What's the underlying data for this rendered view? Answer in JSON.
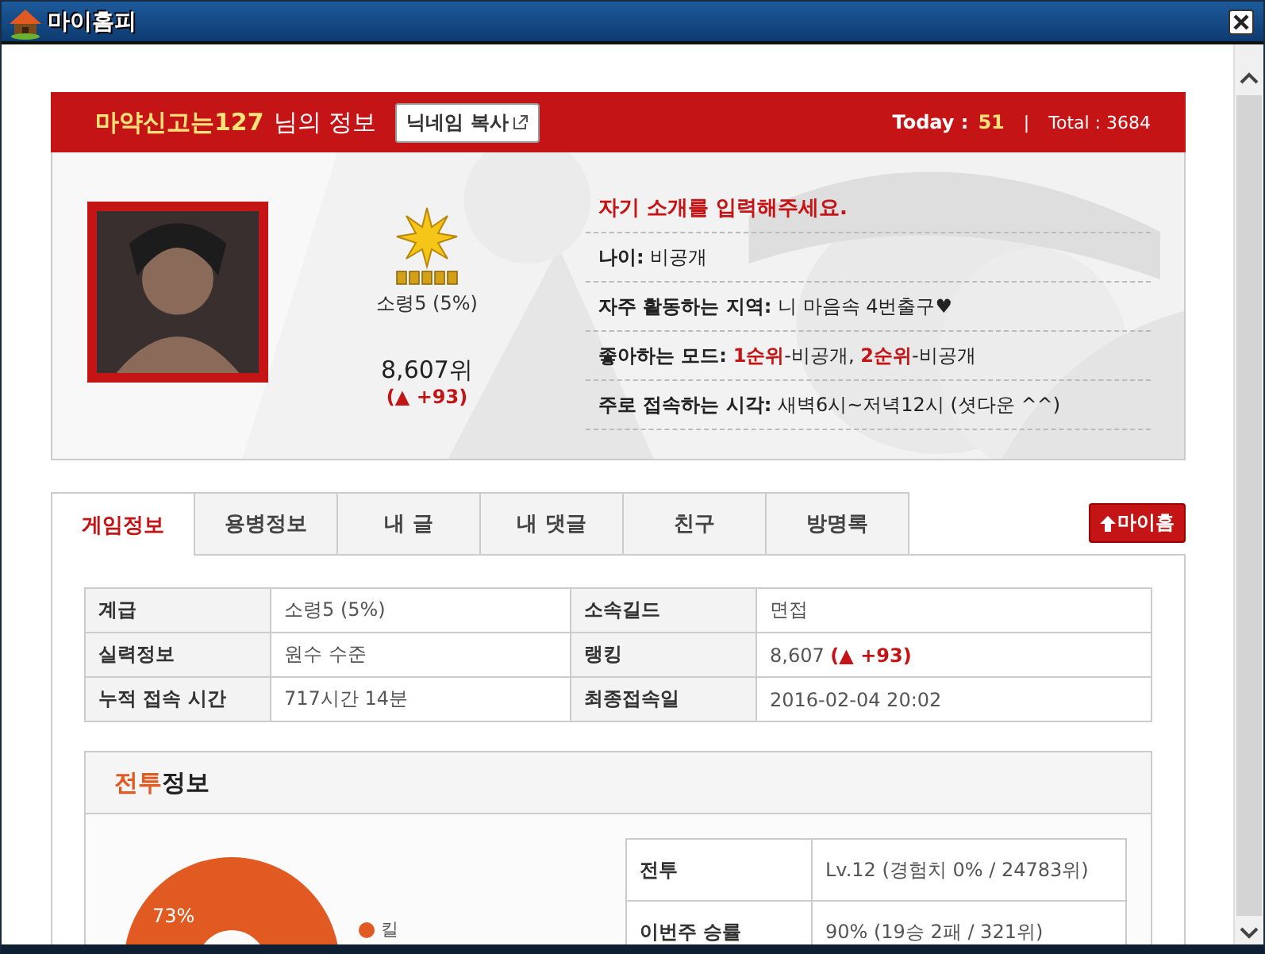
{
  "window": {
    "title": "마이홈피"
  },
  "header": {
    "nickname": "마약신고는127",
    "suffix": "님의 정보",
    "copy_button": "닉네임 복사",
    "today_label": "Today :",
    "today_value": "51",
    "separator": "|",
    "total": "Total : 3684"
  },
  "profile": {
    "rank_name": "소령5 (5%)",
    "rank": "8,607위",
    "rank_change": "(▲ +93)",
    "intro": "자기 소개를 입력해주세요.",
    "fields": [
      {
        "label": "나이:",
        "value": "비공개"
      },
      {
        "label": "자주 활동하는 지역:",
        "value": "니 마음속 4번출구♥"
      },
      {
        "label": "좋아하는 모드:",
        "value": "**1순위**-비공개, **2순위**-비공개"
      },
      {
        "label": "주로 접속하는 시각:",
        "value": "새벽6시~저녁12시 (셧다운 ^^)"
      }
    ]
  },
  "tabs": [
    {
      "label": "게임정보",
      "selected": true
    },
    {
      "label": "용병정보",
      "selected": false
    },
    {
      "label": "내 글",
      "selected": false
    },
    {
      "label": "내 댓글",
      "selected": false
    },
    {
      "label": "친구",
      "selected": false
    },
    {
      "label": "방명록",
      "selected": false
    }
  ],
  "home_button": "마이홈",
  "info_table": {
    "rows": [
      [
        "계급",
        "소령5 (5%)",
        "소속길드",
        "면접"
      ],
      [
        "실력정보",
        "원수 수준",
        "랭킹",
        "8,607 **(▲ +93)**"
      ],
      [
        "누적 접속 시간",
        "717시간 14분",
        "최종접속일",
        "2016-02-04 20:02"
      ]
    ]
  },
  "battle": {
    "title_highlight": "전투",
    "title_rest": "정보",
    "chart_label": "73%",
    "legend": "킬",
    "rows": [
      {
        "label": "전투",
        "value": "Lv.12 (경험치 0% / 24783위)"
      },
      {
        "label": "이번주 승률",
        "value": "90% (19승 2패 / 321위)"
      }
    ]
  }
}
